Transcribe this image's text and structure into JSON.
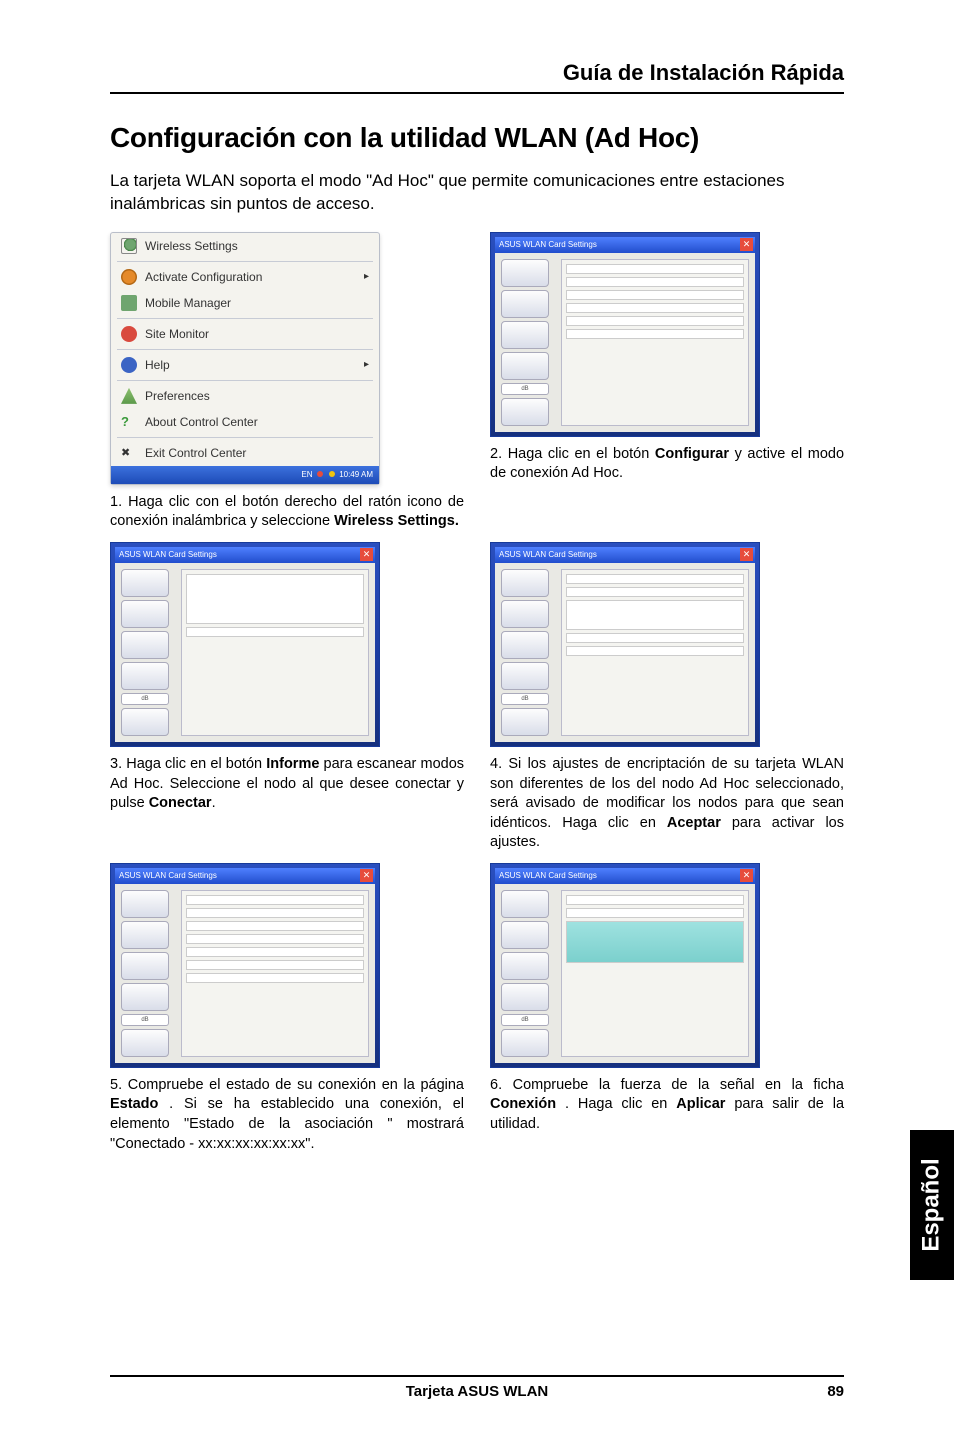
{
  "page_header": "Guía de Instalación Rápida",
  "section_title": "Configuración con la utilidad WLAN (Ad Hoc)",
  "intro_text": "La tarjeta WLAN soporta el modo \"Ad Hoc\" que permite comunicaciones entre estaciones inalámbricas sin puntos de acceso.",
  "menu": {
    "title": "Wireless Settings",
    "items": [
      "Activate Configuration",
      "Mobile Manager",
      "Site Monitor",
      "Help",
      "Preferences",
      "About Control Center",
      "Exit Control Center"
    ],
    "tray_lang": "EN",
    "tray_time": "10:49 AM"
  },
  "dialog_title": "ASUS WLAN Card Settings",
  "steps": {
    "s1_num": "1.",
    "s1_text_a": "Haga clic con el botón derecho del ratón icono de conexión inalámbrica y seleccione ",
    "s1_bold": "Wireless Settings.",
    "s2_num": "2.",
    "s2_text_a": "Haga clic en el botón ",
    "s2_bold": "Configurar",
    "s2_text_b": " y active el modo de conexión Ad Hoc.",
    "s3_num": "3.",
    "s3_text_a": "Haga clic en el botón ",
    "s3_bold_a": "Informe",
    "s3_text_b": " para escanear modos Ad Hoc. Seleccione el nodo al que desee conectar y pulse ",
    "s3_bold_b": "Conectar",
    "s3_text_c": ".",
    "s4_num": "4.",
    "s4_text_a": "Si los ajustes de encriptación de su tarjeta WLAN son diferentes de los del nodo Ad Hoc seleccionado, será avisado de modificar los nodos para que sean idénticos. Haga clic en ",
    "s4_bold": "Aceptar",
    "s4_text_b": " para activar los ajustes.",
    "s5_num": "5.",
    "s5_text_a": "Compruebe el estado de su conexión en la página ",
    "s5_bold": "Estado",
    "s5_text_b": ". Si se ha establecido una conexión, el elemento \"Estado de la asociación \" mostrará \"Conectado - xx:xx:xx:xx:xx:xx\".",
    "s6_num": "6.",
    "s6_text_a": "Compruebe la fuerza de la señal en la ficha ",
    "s6_bold_a": "Conexión",
    "s6_text_b": ". Haga clic en ",
    "s6_bold_b": "Aplicar",
    "s6_text_c": " para salir de la utilidad."
  },
  "side_tab": "Español",
  "footer_title": "Tarjeta ASUS WLAN",
  "footer_page": "89"
}
